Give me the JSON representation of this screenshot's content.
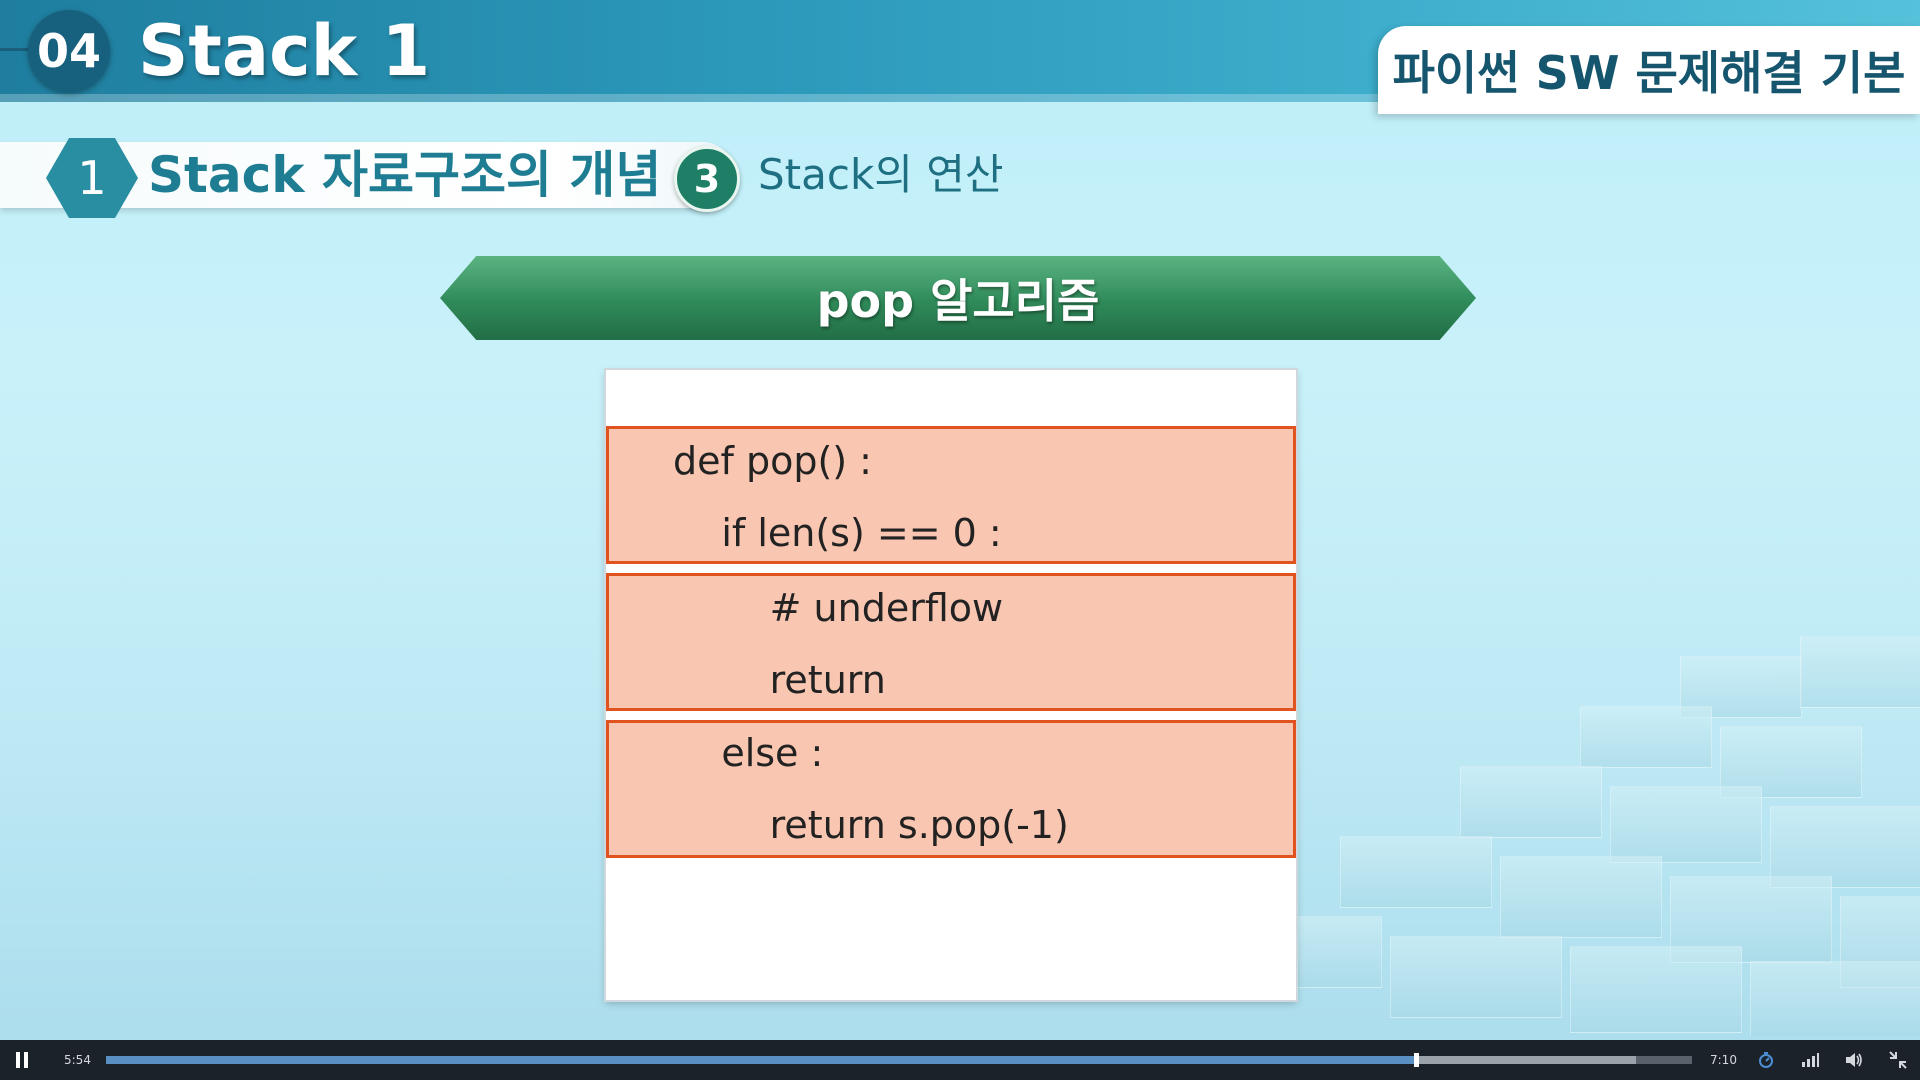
{
  "header": {
    "chapter_number": "04",
    "chapter_title": "Stack 1",
    "course_title": "파이썬 SW 문제해결 기본"
  },
  "section": {
    "number": "1",
    "title": "Stack 자료구조의 개념",
    "sub_number": "3",
    "sub_title": "Stack의 연산"
  },
  "banner": {
    "title": "pop 알고리즘"
  },
  "code": {
    "blocks": [
      [
        "def pop() :",
        "    if len(s) == 0 :"
      ],
      [
        "        # underflow",
        "        return"
      ],
      [
        "    else :",
        "        return s.pop(-1)"
      ]
    ],
    "highlight_fill": "#f9c6b1",
    "highlight_border": "#e0531e"
  },
  "player": {
    "current_time": "5:54",
    "total_time": "7:10",
    "played_fraction": 0.826,
    "buffered_fraction": 0.965,
    "controls": [
      "pause-icon",
      "speed-icon",
      "quality-icon",
      "volume-icon",
      "exit-fullscreen-icon"
    ]
  },
  "colors": {
    "header_blue": "#2c99bb",
    "section_teal": "#2a8ea3",
    "banner_green": "#2f8a59"
  }
}
